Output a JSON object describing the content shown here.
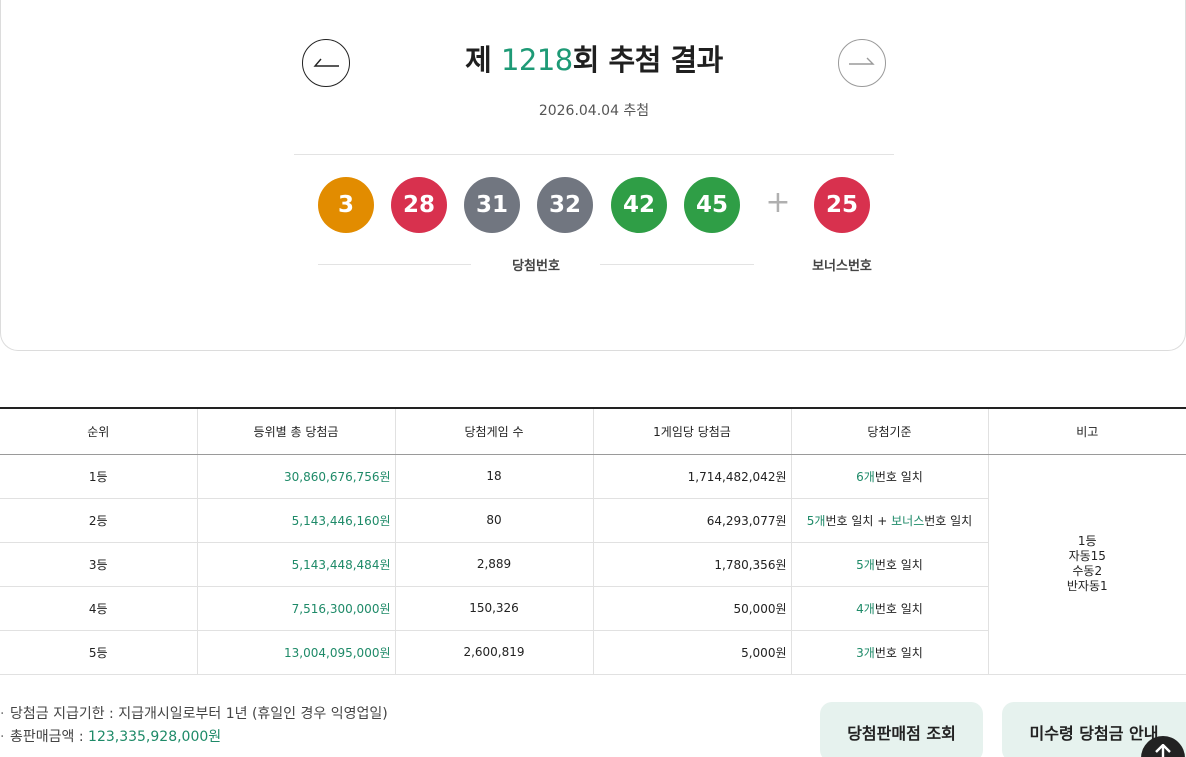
{
  "header": {
    "title_prefix": "제 ",
    "draw_no": "1218",
    "title_suffix": "회 추첨 결과",
    "draw_date": "2026.04.04 추첨",
    "prev_icon": "arrow-left-icon",
    "next_icon": "arrow-right-icon"
  },
  "balls": {
    "main": [
      {
        "value": "3",
        "color": "#e28c00"
      },
      {
        "value": "28",
        "color": "#d8314e"
      },
      {
        "value": "31",
        "color": "#717680"
      },
      {
        "value": "32",
        "color": "#717680"
      },
      {
        "value": "42",
        "color": "#2f9e46"
      },
      {
        "value": "45",
        "color": "#2f9e46"
      }
    ],
    "plus": "+",
    "bonus": {
      "value": "25",
      "color": "#d8314e"
    },
    "main_label": "당첨번호",
    "bonus_label": "보너스번호"
  },
  "table": {
    "headers": [
      "순위",
      "등위별 총 당첨금",
      "당첨게임 수",
      "1게임당 당첨금",
      "당첨기준",
      "비고"
    ],
    "rows": [
      {
        "rank": "1등",
        "total": "30,860,676,756원",
        "games": "18",
        "per_game": "1,714,482,042원",
        "criteria": [
          {
            "t": "6개",
            "g": true
          },
          {
            "t": "번호 일치",
            "g": false
          }
        ]
      },
      {
        "rank": "2등",
        "total": "5,143,446,160원",
        "games": "80",
        "per_game": "64,293,077원",
        "criteria": [
          {
            "t": "5개",
            "g": true
          },
          {
            "t": "번호 일치 + ",
            "g": false
          },
          {
            "t": "보너스",
            "g": true
          },
          {
            "t": "번호 일치",
            "g": false
          }
        ]
      },
      {
        "rank": "3등",
        "total": "5,143,448,484원",
        "games": "2,889",
        "per_game": "1,780,356원",
        "criteria": [
          {
            "t": "5개",
            "g": true
          },
          {
            "t": "번호 일치",
            "g": false
          }
        ]
      },
      {
        "rank": "4등",
        "total": "7,516,300,000원",
        "games": "150,326",
        "per_game": "50,000원",
        "criteria": [
          {
            "t": "4개",
            "g": true
          },
          {
            "t": "번호 일치",
            "g": false
          }
        ]
      },
      {
        "rank": "5등",
        "total": "13,004,095,000원",
        "games": "2,600,819",
        "per_game": "5,000원",
        "criteria": [
          {
            "t": "3개",
            "g": true
          },
          {
            "t": "번호 일치",
            "g": false
          }
        ]
      }
    ],
    "note_lines": [
      "1등",
      "자동15",
      "수동2",
      "반자동1"
    ]
  },
  "info": {
    "bullet": "·",
    "deadline": "당첨금 지급기한 : 지급개시일로부터 1년 (휴일인 경우 익영업일)",
    "sales_label": "총판매금액 : ",
    "sales_value": "123,335,928,000원"
  },
  "buttons": {
    "store_lookup": "당첨판매점 조회",
    "unclaimed": "미수령 당첨금 안내",
    "top_icon": "arrow-up-icon"
  }
}
